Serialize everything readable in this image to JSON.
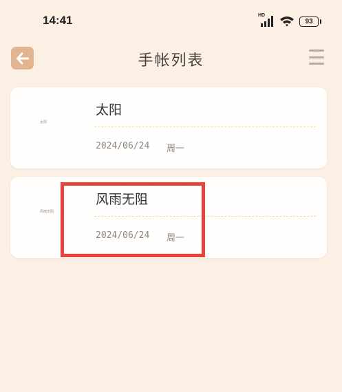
{
  "status_bar": {
    "time": "14:41",
    "network_label": "HD",
    "battery": "93",
    "icons": [
      "signal-icon",
      "wifi-icon",
      "battery-icon"
    ]
  },
  "header": {
    "title": "手帐列表",
    "back_icon": "arrow-left-icon",
    "menu_icon": "hamburger-menu-icon"
  },
  "entries": [
    {
      "thumb_text": "太阳",
      "title": "太阳",
      "date": "2024/06/24",
      "weekday": "周一"
    },
    {
      "thumb_text": "风雨无阻",
      "title": "风雨无阻",
      "date": "2024/06/24",
      "weekday": "周一"
    }
  ],
  "colors": {
    "background": "#fcefe4",
    "accent": "#e2b48f",
    "highlight": "#e8423c",
    "divider": "#f0e07a"
  }
}
